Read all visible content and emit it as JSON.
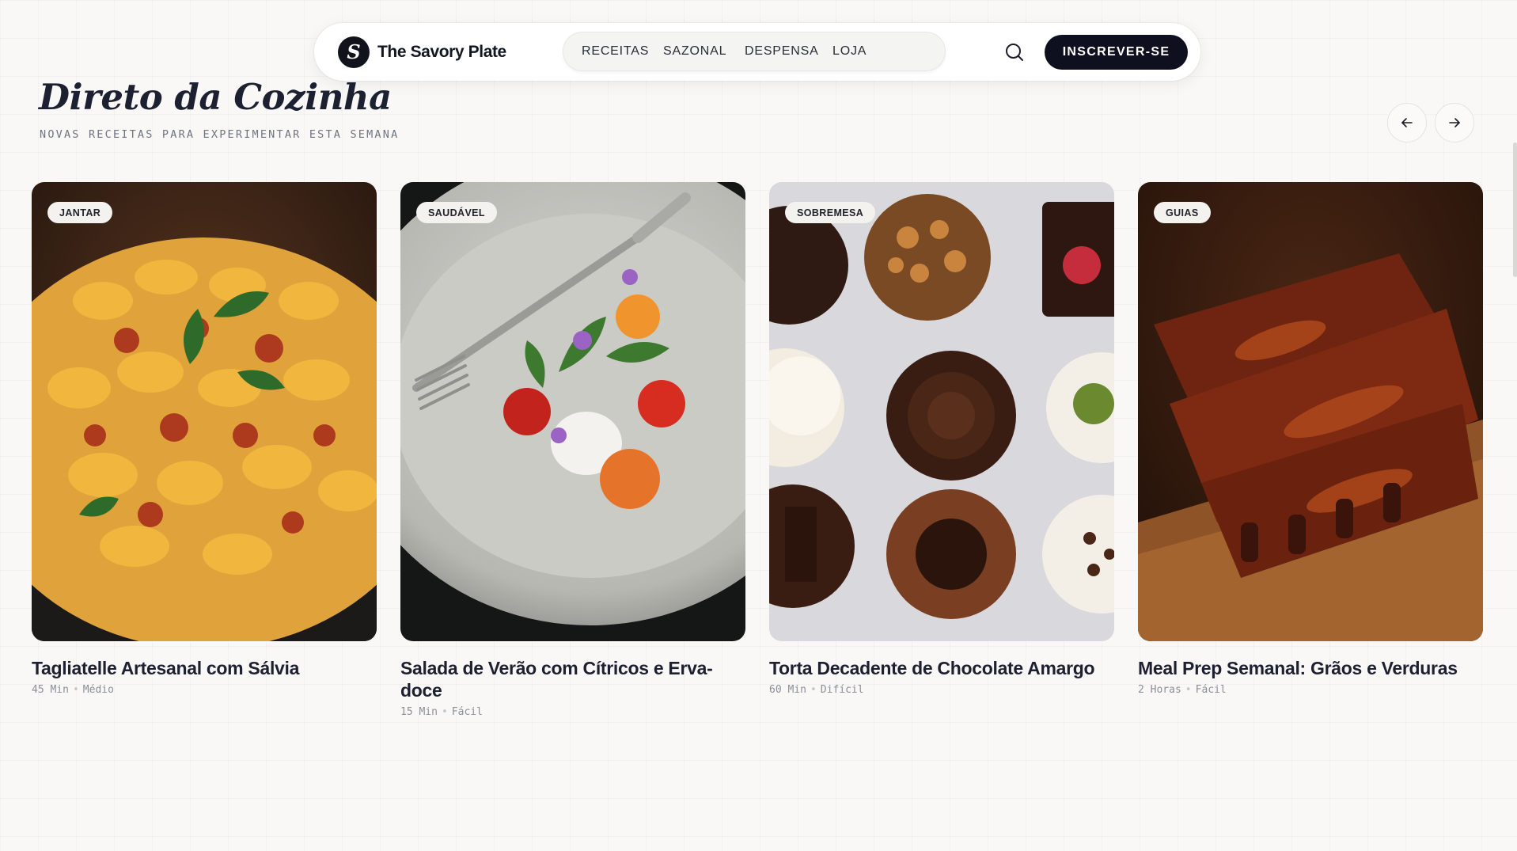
{
  "nav": {
    "brand_letter": "S",
    "brand_name": "The Savory Plate",
    "items": [
      "RECEITAS",
      "SAZONAL",
      "DESPENSA",
      "LOJA"
    ],
    "search_icon": "search-icon",
    "subscribe_label": "INSCREVER-SE"
  },
  "section": {
    "title": "Direto da Cozinha",
    "subtitle": "NOVAS RECEITAS PARA EXPERIMENTAR ESTA SEMANA",
    "prev_icon": "arrow-left-icon",
    "next_icon": "arrow-right-icon"
  },
  "cards": [
    {
      "badge": "JANTAR",
      "title": "Tagliatelle Artesanal com Sálvia",
      "time": "45 Min",
      "difficulty": "Médio",
      "image": "pasta-photo"
    },
    {
      "badge": "SAUDÁVEL",
      "title": "Salada de Verão com Cítricos e Erva-doce",
      "time": "15 Min",
      "difficulty": "Fácil",
      "image": "salad-photo"
    },
    {
      "badge": "SOBREMESA",
      "title": "Torta Decadente de Chocolate Amargo",
      "time": "60 Min",
      "difficulty": "Difícil",
      "image": "desserts-photo"
    },
    {
      "badge": "GUIAS",
      "title": "Meal Prep Semanal: Grãos e Verduras",
      "time": "2 Horas",
      "difficulty": "Fácil",
      "image": "ribs-photo"
    }
  ],
  "colors": {
    "accent_dark": "#0e1020",
    "background": "#f9f8f6",
    "badge_bg": "#f3f2ef",
    "meta_text": "#8a8f98"
  }
}
